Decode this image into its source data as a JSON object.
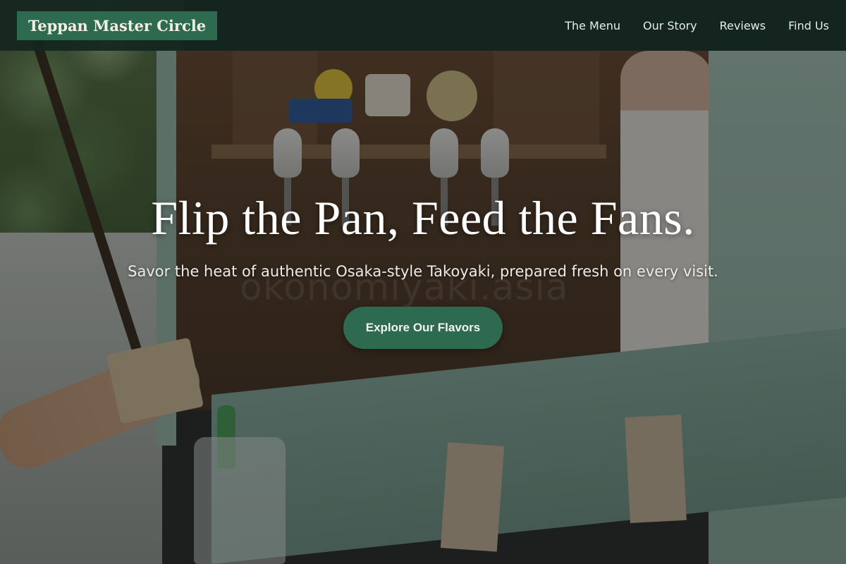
{
  "header": {
    "brand": "Teppan Master Circle",
    "nav": [
      "The Menu",
      "Our Story",
      "Reviews",
      "Find Us"
    ]
  },
  "hero": {
    "title": "Flip the Pan, Feed the Fans.",
    "subtitle": "Savor the heat of authentic Osaka-style Takoyaki, prepared fresh on every visit.",
    "cta_label": "Explore Our Flavors",
    "watermark": "okonomiyaki.asia"
  },
  "colors": {
    "accent": "#2d6a4f",
    "header_bg": "#13261f"
  }
}
